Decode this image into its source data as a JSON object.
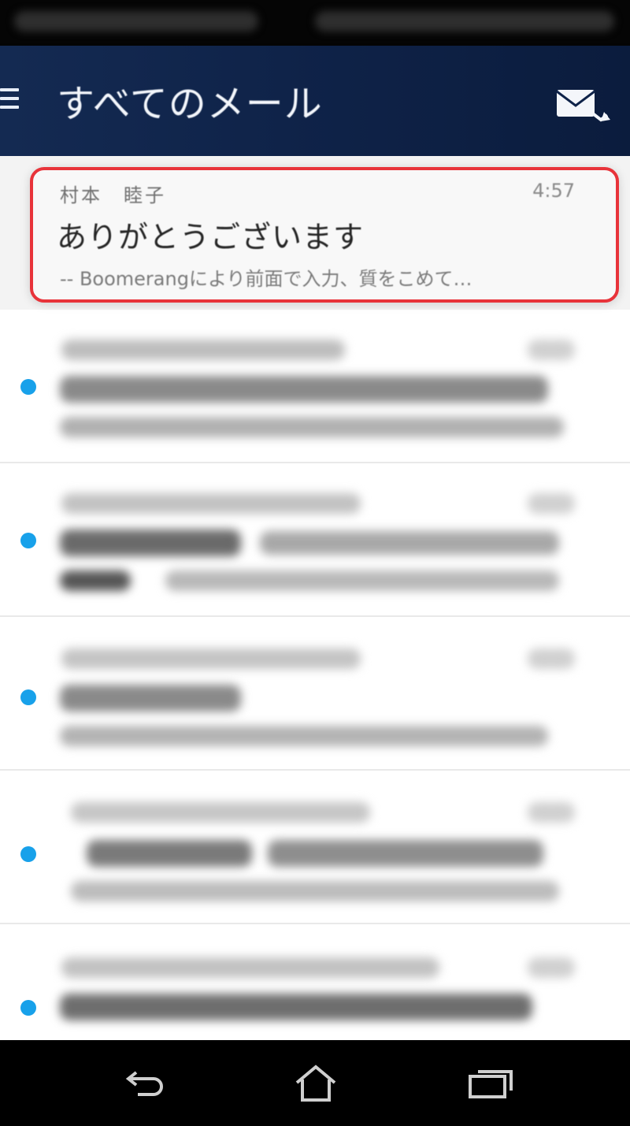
{
  "header": {
    "title": "すべてのメール",
    "menu_icon": "hamburger-menu-icon",
    "compose_icon": "compose-mail-icon"
  },
  "mail_list": {
    "highlighted_item": {
      "sender": "村本　睦子",
      "time": "4:57",
      "subject": "ありがとうございます",
      "preview": "-- Boomerangにより前面で入力、質をこめて…"
    },
    "blurred_item_count_note": "",
    "colors": {
      "highlight_border": "#e8333a",
      "unread_dot": "#18a1ea",
      "app_bar": "#0f2349"
    }
  },
  "nav_bar": {
    "back_icon": "back-icon",
    "home_icon": "home-icon",
    "recents_icon": "recent-apps-icon"
  }
}
